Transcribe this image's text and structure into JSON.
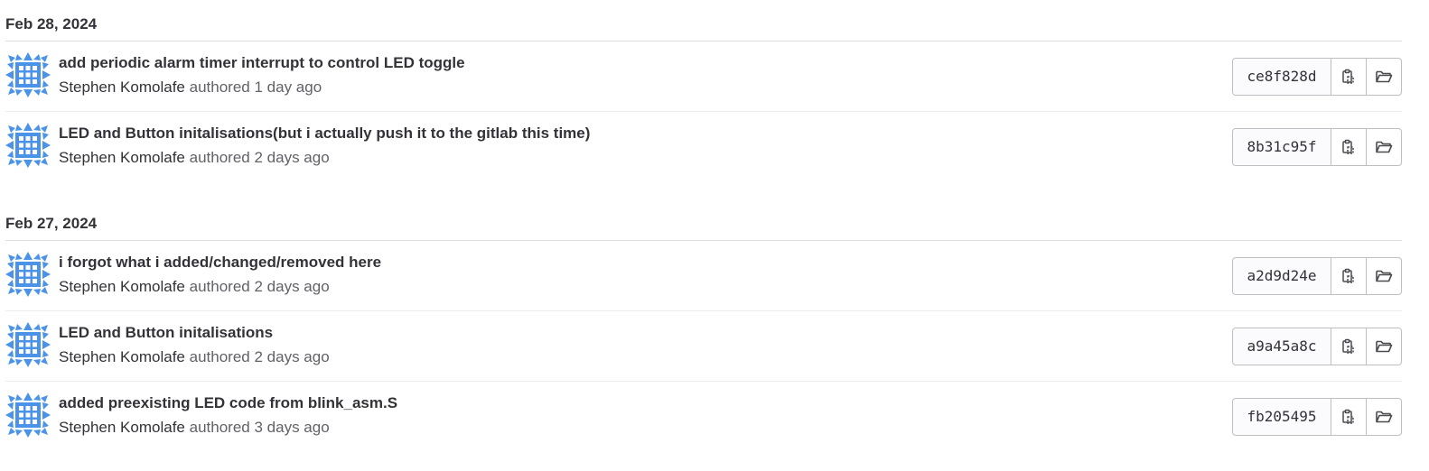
{
  "groups": [
    {
      "date": "Feb 28, 2024",
      "commits": [
        {
          "title": "add periodic alarm timer interrupt to control LED toggle",
          "author": "Stephen Komolafe",
          "verb": "authored",
          "time": "1 day ago",
          "sha": "ce8f828d"
        },
        {
          "title": "LED and Button initalisations(but i actually push it to the gitlab this time)",
          "author": "Stephen Komolafe",
          "verb": "authored",
          "time": "2 days ago",
          "sha": "8b31c95f"
        }
      ]
    },
    {
      "date": "Feb 27, 2024",
      "commits": [
        {
          "title": "i forgot what i added/changed/removed here",
          "author": "Stephen Komolafe",
          "verb": "authored",
          "time": "2 days ago",
          "sha": "a2d9d24e"
        },
        {
          "title": "LED and Button initalisations",
          "author": "Stephen Komolafe",
          "verb": "authored",
          "time": "2 days ago",
          "sha": "a9a45a8c"
        },
        {
          "title": "added preexisting LED code from blink_asm.S",
          "author": "Stephen Komolafe",
          "verb": "authored",
          "time": "3 days ago",
          "sha": "fb205495"
        }
      ]
    }
  ],
  "icons": {
    "avatar": "identicon-avatar",
    "copy": "copy-to-clipboard-icon",
    "browse": "folder-open-icon"
  },
  "colors": {
    "avatar": "#4a93e8",
    "text": "#333238",
    "muted": "#626168",
    "border": "#bfbfc3"
  }
}
